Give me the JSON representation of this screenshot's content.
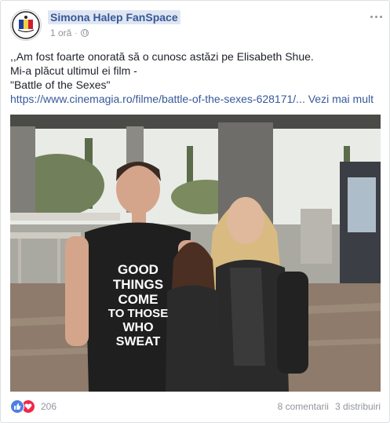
{
  "post": {
    "page_name": "Simona Halep FanSpace",
    "time": "1 oră",
    "separator": "·",
    "text_lines": [
      ",,Am fost foarte onorată să o cunosc astăzi pe Elisabeth Shue.",
      "Mi-a plăcut ultimul ei film -",
      "\"Battle of the Sexes\""
    ],
    "link": "https://www.cinemagia.ro/filme/battle-of-the-sexes-628171/...",
    "see_more": "Vezi mai mult",
    "shirt_text": [
      "GOOD",
      "THINGS",
      "COME",
      "TO THOSE",
      "WHO",
      "SWEAT"
    ]
  },
  "footer": {
    "reaction_count": "206",
    "comments": "8 comentarii",
    "shares": "3 distribuiri"
  },
  "colors": {
    "link": "#365899",
    "meta": "#90949c",
    "like": "#4d7fe3",
    "love": "#f0284a"
  },
  "icons": [
    "avatar-logo",
    "globe-icon",
    "more-options-icon",
    "like-icon",
    "love-icon"
  ]
}
